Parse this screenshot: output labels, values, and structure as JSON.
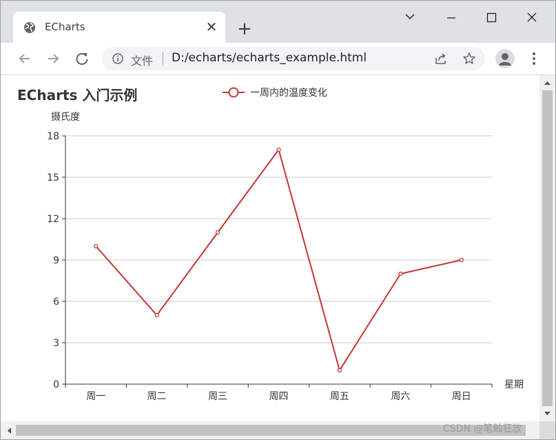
{
  "browser": {
    "tab_title": "ECharts",
    "address_chip": "文件",
    "url": "D:/echarts/echarts_example.html"
  },
  "watermark": "CSDN @笔触狂放",
  "colors": {
    "series": "#c23531",
    "tabstrip": "#dee1e6",
    "omnibox": "#f1f3f4"
  },
  "icons": {
    "favicon": "globe-icon",
    "close": "close-icon",
    "new_tab": "plus-icon",
    "tab_search": "chevron-down-icon",
    "minimize": "minimize-icon",
    "maximize": "maximize-icon",
    "window_close": "close-icon",
    "back": "arrow-left-icon",
    "forward": "arrow-right-icon",
    "reload": "reload-icon",
    "info": "info-icon",
    "share": "share-icon",
    "bookmark": "star-icon",
    "profile": "avatar-icon",
    "menu": "kebab-menu-icon"
  },
  "chart_data": {
    "type": "line",
    "title": "ECharts 入门示例",
    "xlabel": "星期",
    "ylabel": "摄氏度",
    "categories": [
      "周一",
      "周二",
      "周三",
      "周四",
      "周五",
      "周六",
      "周日"
    ],
    "series": [
      {
        "name": "一周内的温度变化",
        "values": [
          10,
          5,
          11,
          17,
          1,
          8,
          9
        ]
      }
    ],
    "ylim": [
      0,
      18
    ],
    "yticks": [
      0,
      3,
      6,
      9,
      12,
      15,
      18
    ],
    "grid": true,
    "legend_position": "top-center"
  }
}
